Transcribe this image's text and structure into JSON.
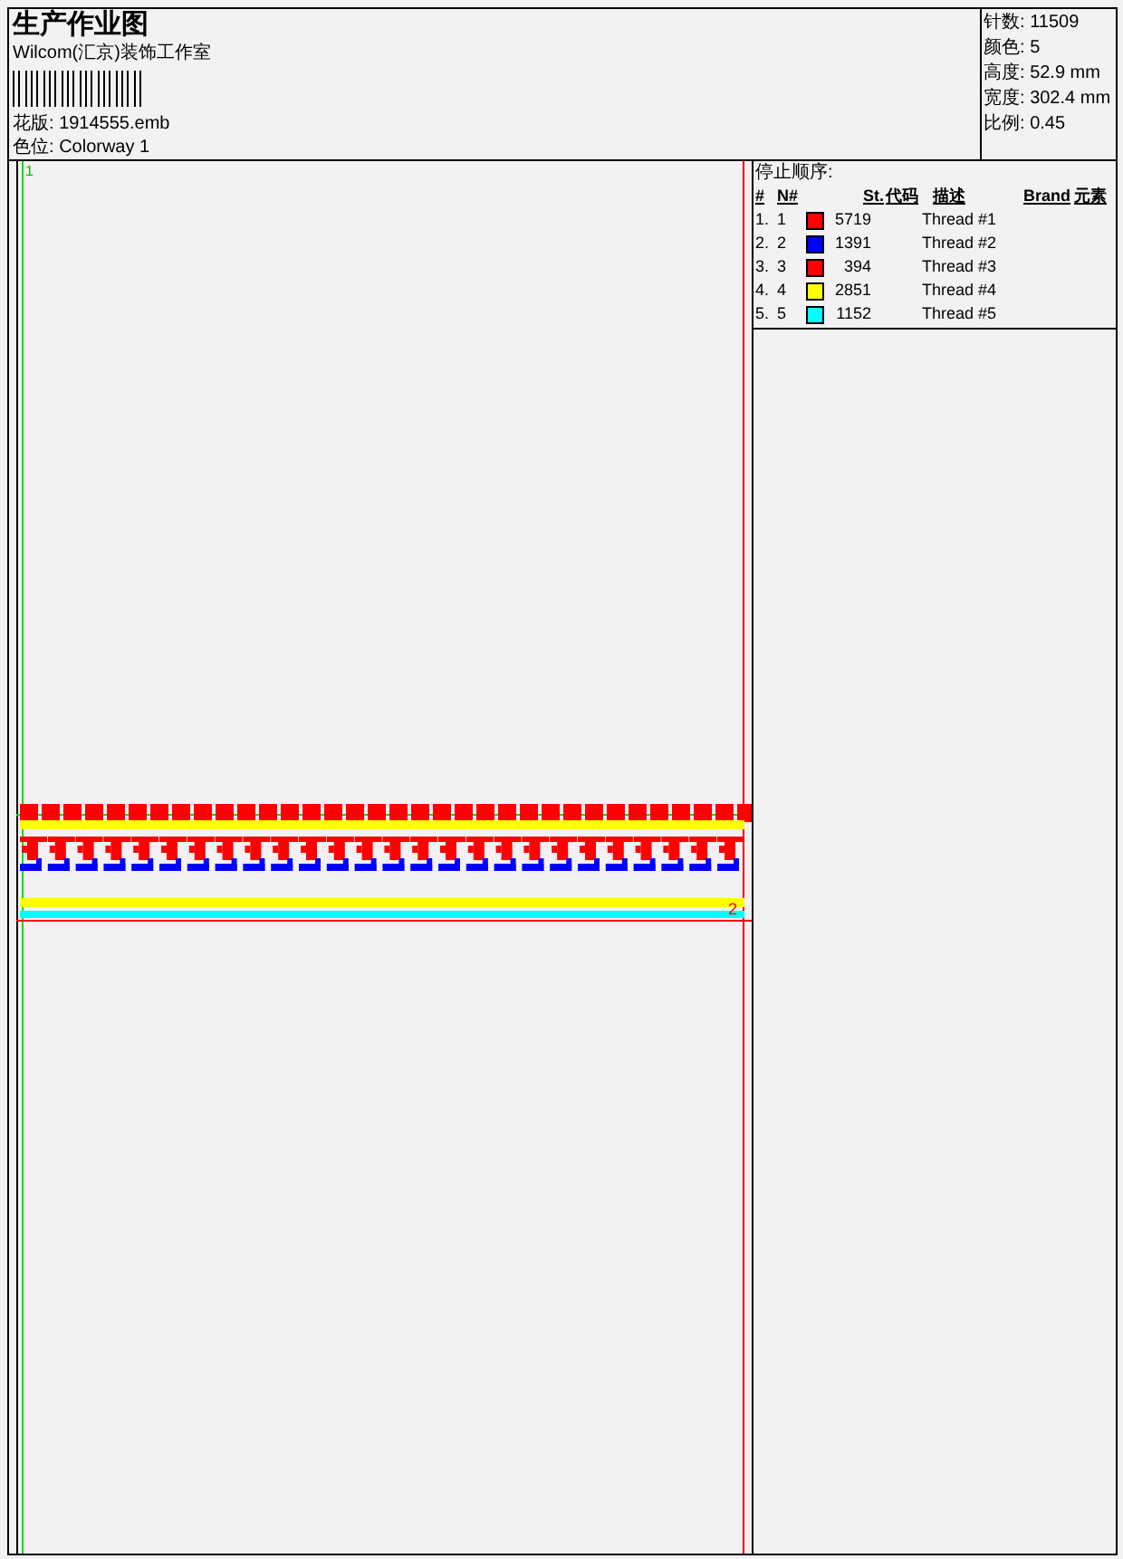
{
  "title": "生产作业图",
  "company": "Wilcom(汇京)装饰工作室",
  "design_file": {
    "label": "花版:",
    "value": "1914555.emb"
  },
  "colorway": {
    "label": "色位:",
    "value": "Colorway 1"
  },
  "stats": [
    {
      "label": "针数:",
      "value": "11509"
    },
    {
      "label": "颜色:",
      "value": "5"
    },
    {
      "label": "高度:",
      "value": "52.9 mm"
    },
    {
      "label": "宽度:",
      "value": "302.4 mm"
    },
    {
      "label": "比例:",
      "value": "0.45"
    }
  ],
  "stop_sequence": {
    "title": "停止顺序:",
    "columns": [
      "#",
      "N#",
      "St.",
      "代码",
      "描述",
      "Brand",
      "元素"
    ],
    "rows": [
      {
        "index": "1.",
        "needle": "1",
        "color": "#ff0000",
        "stitches": "5719",
        "description": "Thread #1"
      },
      {
        "index": "2.",
        "needle": "2",
        "color": "#0000ff",
        "stitches": "1391",
        "description": "Thread #2"
      },
      {
        "index": "3.",
        "needle": "3",
        "color": "#ff0000",
        "stitches": "394",
        "description": "Thread #3"
      },
      {
        "index": "4.",
        "needle": "4",
        "color": "#ffff00",
        "stitches": "2851",
        "description": "Thread #4"
      },
      {
        "index": "5.",
        "needle": "5",
        "color": "#00ffff",
        "stitches": "1152",
        "description": "Thread #5"
      }
    ]
  },
  "canvas": {
    "start_marker": "1",
    "end_marker": "2"
  }
}
